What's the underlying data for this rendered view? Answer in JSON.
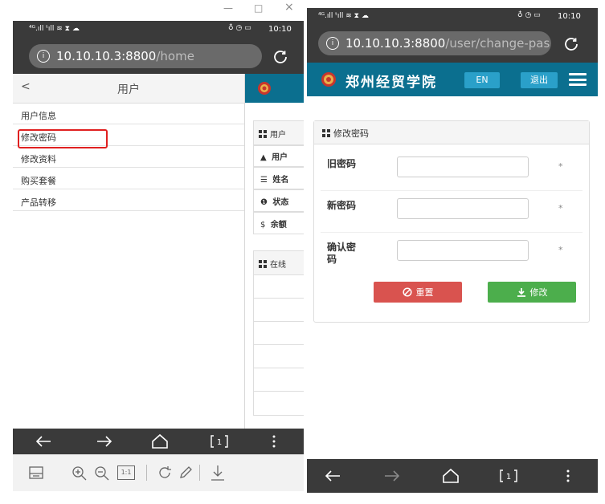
{
  "left_screen": {
    "window_controls": {
      "minimize": "—",
      "maximize": "□",
      "close": "×"
    },
    "status_bar": {
      "signals": "⁴ᴳ.ıll ᵗıll ≋ ⧗ ☁",
      "right_icons": "♁ ◷ ▭",
      "time": "10:10"
    },
    "address_bar": {
      "host": "10.10.10.3:8800",
      "path": "/home"
    },
    "drawer": {
      "back_label": "<",
      "title": "用户",
      "menu_items": [
        {
          "label": "用户信息"
        },
        {
          "label": "修改密码"
        },
        {
          "label": "修改资料"
        },
        {
          "label": "购买套餐"
        },
        {
          "label": "产品转移"
        }
      ]
    },
    "background_page": {
      "panel1_title": "用户",
      "rows": [
        {
          "icon": "user-icon",
          "text": "用户"
        },
        {
          "icon": "list-icon",
          "text": "姓名"
        },
        {
          "icon": "info-icon",
          "text": "状态"
        },
        {
          "icon": "dollar-icon",
          "text": "余额"
        }
      ],
      "panel2_title": "在线"
    },
    "toolbar": {
      "page_label": "1:1"
    }
  },
  "right_screen": {
    "status_bar": {
      "signals": "⁴ᴳ.ıll ᵗıll ≋ ⧗ ☁",
      "right_icons": "♁ ◷ ▭",
      "time": "10:10"
    },
    "address_bar": {
      "host": "10.10.10.3:8800",
      "path": "/user/change-pas"
    },
    "header": {
      "site_name": "郑州经贸学院",
      "lang_button": "EN",
      "logout_button": "退出"
    },
    "panel": {
      "title": "修改密码",
      "fields": [
        {
          "label": "旧密码",
          "required": "*"
        },
        {
          "label": "新密码",
          "required": "*"
        },
        {
          "label": "确认密码",
          "required": "*"
        }
      ],
      "reset_button": "重置",
      "submit_button": "修改"
    },
    "tab_count": "1"
  },
  "colors": {
    "brand": "#0b6f8f",
    "danger": "#d9534f",
    "success": "#4cae4c",
    "highlight": "#e02020"
  }
}
